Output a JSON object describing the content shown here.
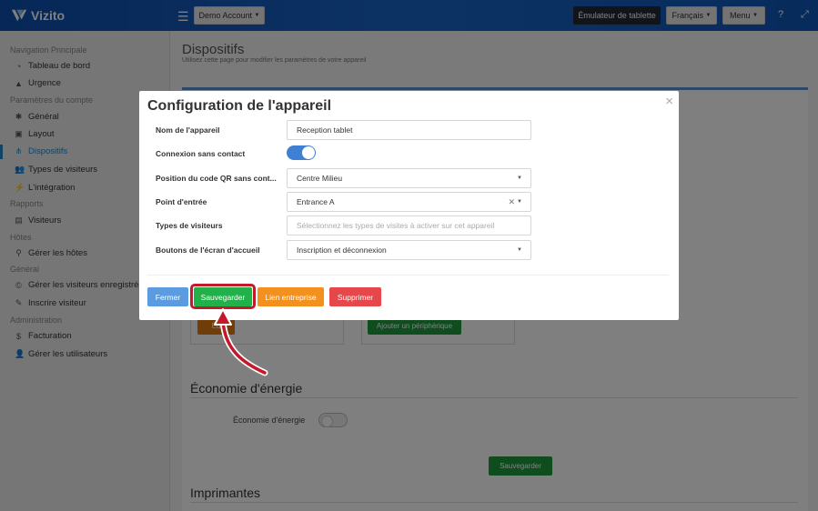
{
  "topbar": {
    "brand": "Vizito",
    "account_label": "Demo Account",
    "emulator_label": "Émulateur de tablette",
    "language_label": "Français",
    "menu_label": "Menu"
  },
  "sidebar": {
    "sections": [
      {
        "title": "Navigation Principale",
        "items": [
          {
            "label": "Tableau de bord",
            "icon": "dashboard-icon"
          },
          {
            "label": "Urgence",
            "icon": "warning-icon"
          }
        ]
      },
      {
        "title": "Paramètres du compte",
        "items": [
          {
            "label": "Général",
            "icon": "gear-icon"
          },
          {
            "label": "Layout",
            "icon": "image-icon"
          },
          {
            "label": "Dispositifs",
            "icon": "sitemap-icon",
            "active": true
          },
          {
            "label": "Types de visiteurs",
            "icon": "users-icon"
          },
          {
            "label": "L'intégration",
            "icon": "plug-icon"
          }
        ]
      },
      {
        "title": "Rapports",
        "items": [
          {
            "label": "Visiteurs",
            "icon": "list-icon"
          }
        ]
      },
      {
        "title": "Hôtes",
        "items": [
          {
            "label": "Gérer les hôtes",
            "icon": "person-icon"
          }
        ]
      },
      {
        "title": "Général",
        "items": [
          {
            "label": "Gérer les visiteurs enregistrés",
            "icon": "copyright-icon"
          },
          {
            "label": "Inscrire visiteur",
            "icon": "pencil-icon"
          }
        ]
      },
      {
        "title": "Administration",
        "items": [
          {
            "label": "Facturation",
            "icon": "dollar-icon"
          },
          {
            "label": "Gérer les utilisateurs",
            "icon": "user-gear-icon"
          }
        ]
      }
    ]
  },
  "page": {
    "title": "Dispositifs",
    "subtitle": "Utilisez cette page pour modifier les paramètres de votre appareil",
    "edit_button_partial": "Éd",
    "add_device_button": "Ajouter un périphérique",
    "energy_heading": "Économie d'énergie",
    "energy_label": "Économie d'énergie",
    "save_button": "Sauvegarder",
    "printers_heading": "Imprimantes"
  },
  "modal": {
    "title": "Configuration de l'appareil",
    "close_glyph": "×",
    "fields": {
      "device_name_label": "Nom de l'appareil",
      "device_name_value": "Reception tablet",
      "contactless_label": "Connexion sans contact",
      "qr_position_label": "Position du code QR sans cont...",
      "qr_position_value": "Centre Milieu",
      "entry_point_label": "Point d'entrée",
      "entry_point_value": "Entrance A",
      "visitor_types_label": "Types de visiteurs",
      "visitor_types_placeholder": "Sélectionnez les types de visites à activer sur cet appareil",
      "home_buttons_label": "Boutons de l'écran d'accueil",
      "home_buttons_value": "Inscription et déconnexion"
    },
    "contactless_enabled": true,
    "buttons": {
      "close": "Fermer",
      "save": "Sauvegarder",
      "company_link": "Lien entreprise",
      "delete": "Supprimer"
    }
  },
  "colors": {
    "topbar": "#1964c8",
    "accent": "#1e88c8",
    "save_green": "#22b04a",
    "highlight_red": "#c4192a"
  }
}
